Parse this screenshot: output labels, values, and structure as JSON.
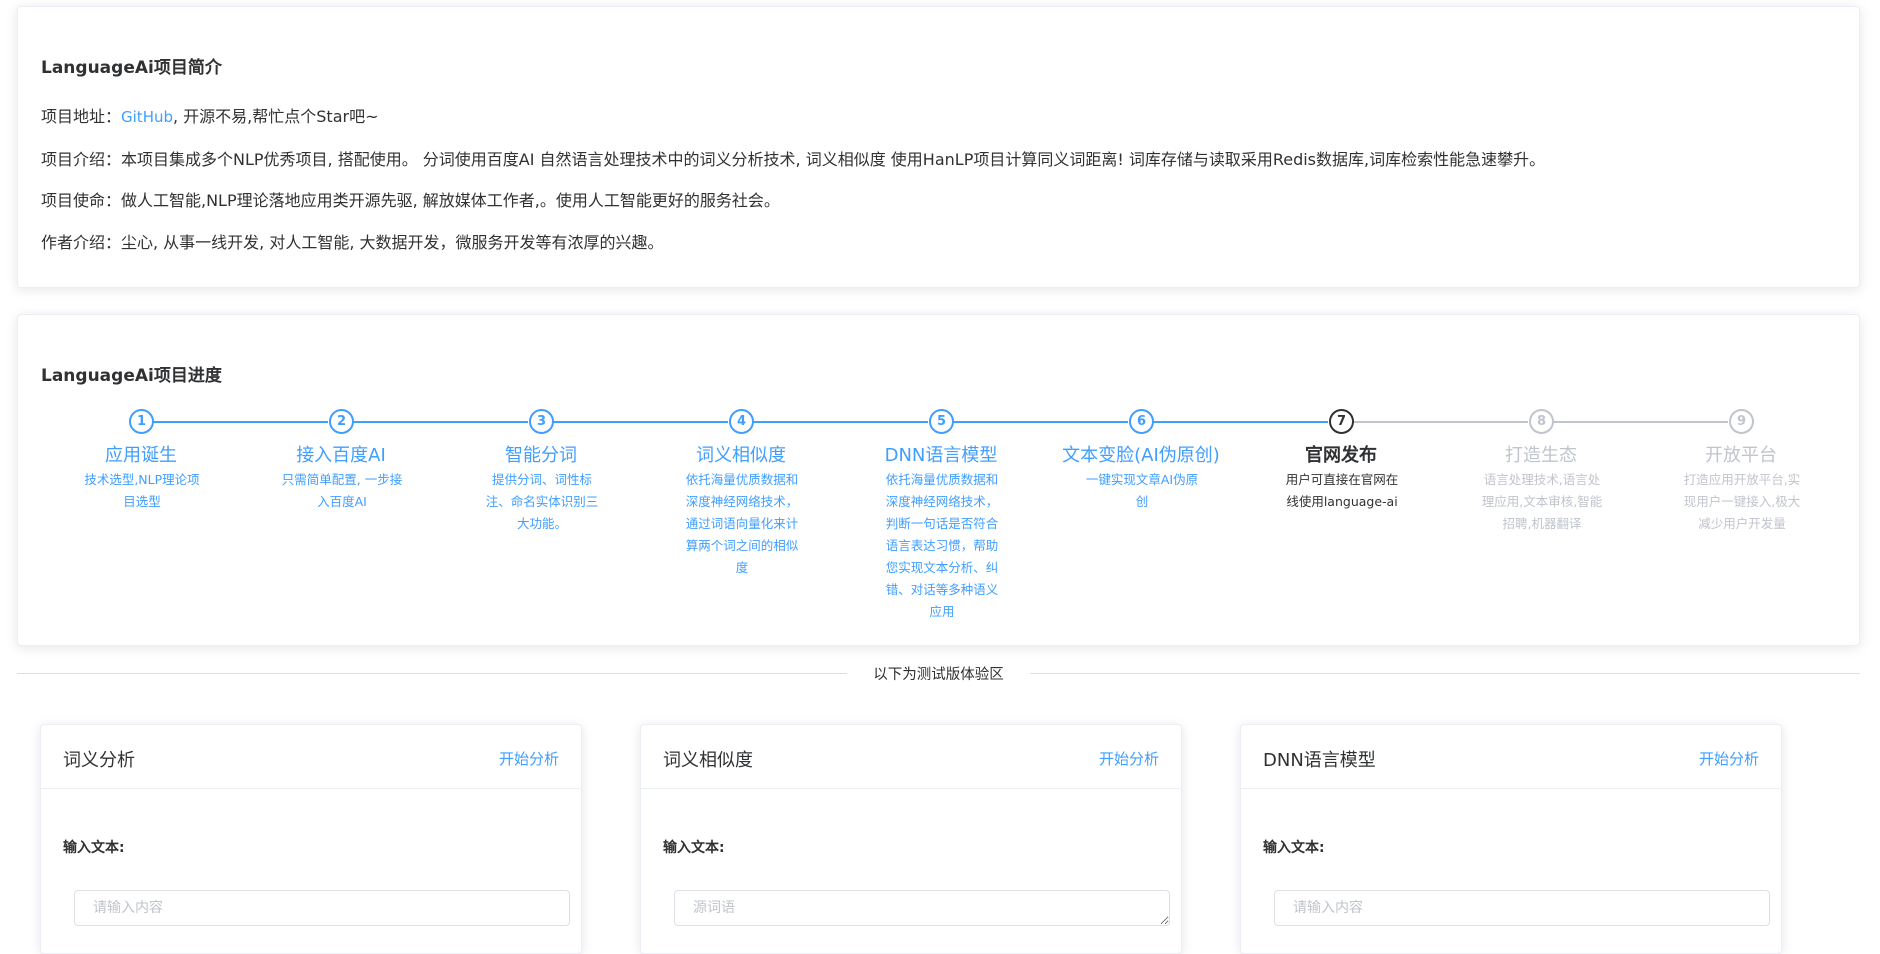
{
  "intro": {
    "title": "LanguageAi项目简介",
    "address_label": "项目地址：",
    "address_link": "GitHub",
    "address_tail": ", 开源不易,帮忙点个Star吧~",
    "description": "项目介绍：本项目集成多个NLP优秀项目, 搭配使用。 分词使用百度AI 自然语言处理技术中的词义分析技术, 词义相似度 使用HanLP项目计算同义词距离! 词库存储与读取采用Redis数据库,词库检索性能急速攀升。",
    "mission": "项目使命：做人工智能,NLP理论落地应用类开源先驱, 解放媒体工作者,。使用人工智能更好的服务社会。",
    "author": "作者介绍：尘心, 从事一线开发, 对人工智能, 大数据开发，微服务开发等有浓厚的兴趣。"
  },
  "progress": {
    "title": "LanguageAi项目进度",
    "steps": [
      {
        "num": "1",
        "title": "应用诞生",
        "desc": "技术选型,NLP理论项目选型",
        "status": "finish"
      },
      {
        "num": "2",
        "title": "接入百度AI",
        "desc": "只需简单配置, 一步接入百度AI",
        "status": "finish"
      },
      {
        "num": "3",
        "title": "智能分词",
        "desc": "提供分词、词性标注、命名实体识别三大功能。",
        "status": "finish"
      },
      {
        "num": "4",
        "title": "词义相似度",
        "desc": "依托海量优质数据和深度神经网络技术，通过词语向量化来计算两个词之间的相似度",
        "status": "finish"
      },
      {
        "num": "5",
        "title": "DNN语言模型",
        "desc": "依托海量优质数据和深度神经网络技术，判断一句话是否符合语言表达习惯，帮助您实现文本分析、纠错、对话等多种语义应用",
        "status": "finish"
      },
      {
        "num": "6",
        "title": "文本变脸(AI伪原创)",
        "desc": "一键实现文章AI伪原创",
        "status": "finish"
      },
      {
        "num": "7",
        "title": "官网发布",
        "desc": "用户可直接在官网在线使用language-ai",
        "status": "process"
      },
      {
        "num": "8",
        "title": "打造生态",
        "desc": "语言处理技术,语言处理应用,文本审核,智能招聘,机器翻译",
        "status": "wait"
      },
      {
        "num": "9",
        "title": "开放平台",
        "desc": "打造应用开放平台,实现用户一键接入,极大减少用户开发量",
        "status": "wait"
      }
    ]
  },
  "divider": {
    "text": "以下为测试版体验区"
  },
  "demos": [
    {
      "title": "词义分析",
      "action": "开始分析",
      "label": "输入文本:",
      "placeholder": "请输入内容"
    },
    {
      "title": "词义相似度",
      "action": "开始分析",
      "label": "输入文本:",
      "placeholder": "源词语"
    },
    {
      "title": "DNN语言模型",
      "action": "开始分析",
      "label": "输入文本:",
      "placeholder": "请输入内容"
    }
  ],
  "colors": {
    "accent": "#409eff",
    "text": "#303133",
    "muted": "#c0c4cc"
  }
}
